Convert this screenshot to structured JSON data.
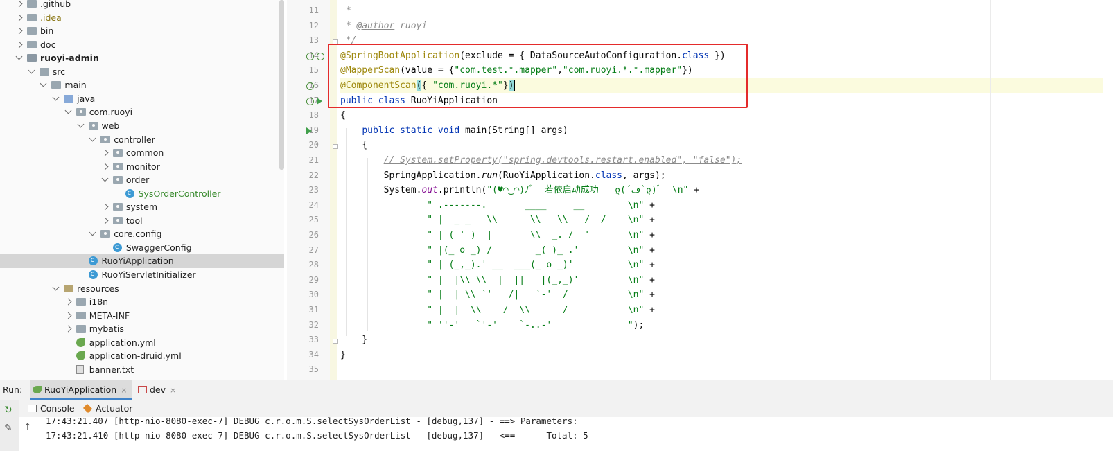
{
  "project_tree": {
    "items": [
      {
        "label": ".github",
        "depth": 0,
        "expanded": false,
        "icon": "folder",
        "style": ""
      },
      {
        "label": ".idea",
        "depth": 0,
        "expanded": false,
        "icon": "folder",
        "style": "yellow"
      },
      {
        "label": "bin",
        "depth": 0,
        "expanded": false,
        "icon": "folder",
        "style": ""
      },
      {
        "label": "doc",
        "depth": 0,
        "expanded": false,
        "icon": "folder",
        "style": ""
      },
      {
        "label": "ruoyi-admin",
        "depth": 0,
        "expanded": true,
        "icon": "module",
        "style": "bold"
      },
      {
        "label": "src",
        "depth": 1,
        "expanded": true,
        "icon": "folder",
        "style": ""
      },
      {
        "label": "main",
        "depth": 2,
        "expanded": true,
        "icon": "folder",
        "style": ""
      },
      {
        "label": "java",
        "depth": 3,
        "expanded": true,
        "icon": "src",
        "style": ""
      },
      {
        "label": "com.ruoyi",
        "depth": 4,
        "expanded": true,
        "icon": "pkg",
        "style": ""
      },
      {
        "label": "web",
        "depth": 5,
        "expanded": true,
        "icon": "pkg",
        "style": ""
      },
      {
        "label": "controller",
        "depth": 6,
        "expanded": true,
        "icon": "pkg",
        "style": ""
      },
      {
        "label": "common",
        "depth": 7,
        "expanded": false,
        "icon": "pkg",
        "style": ""
      },
      {
        "label": "monitor",
        "depth": 7,
        "expanded": false,
        "icon": "pkg",
        "style": ""
      },
      {
        "label": "order",
        "depth": 7,
        "expanded": true,
        "icon": "pkg",
        "style": ""
      },
      {
        "label": "SysOrderController",
        "depth": 8,
        "expanded": null,
        "icon": "class",
        "style": "green"
      },
      {
        "label": "system",
        "depth": 7,
        "expanded": false,
        "icon": "pkg",
        "style": ""
      },
      {
        "label": "tool",
        "depth": 7,
        "expanded": false,
        "icon": "pkg",
        "style": ""
      },
      {
        "label": "core.config",
        "depth": 6,
        "expanded": true,
        "icon": "pkg",
        "style": ""
      },
      {
        "label": "SwaggerConfig",
        "depth": 7,
        "expanded": null,
        "icon": "class",
        "style": ""
      },
      {
        "label": "RuoYiApplication",
        "depth": 5,
        "expanded": null,
        "icon": "class",
        "style": "",
        "selected": true
      },
      {
        "label": "RuoYiServletInitializer",
        "depth": 5,
        "expanded": null,
        "icon": "class",
        "style": ""
      },
      {
        "label": "resources",
        "depth": 3,
        "expanded": true,
        "icon": "res",
        "style": ""
      },
      {
        "label": "i18n",
        "depth": 4,
        "expanded": false,
        "icon": "folder",
        "style": ""
      },
      {
        "label": "META-INF",
        "depth": 4,
        "expanded": false,
        "icon": "folder",
        "style": ""
      },
      {
        "label": "mybatis",
        "depth": 4,
        "expanded": false,
        "icon": "folder",
        "style": ""
      },
      {
        "label": "application.yml",
        "depth": 4,
        "expanded": null,
        "icon": "yml",
        "style": ""
      },
      {
        "label": "application-druid.yml",
        "depth": 4,
        "expanded": null,
        "icon": "yml",
        "style": ""
      },
      {
        "label": "banner.txt",
        "depth": 4,
        "expanded": null,
        "icon": "txt",
        "style": ""
      }
    ]
  },
  "editor": {
    "first_line": 11,
    "lines": [
      [
        [
          "cmt",
          " *"
        ]
      ],
      [
        [
          "cmt",
          " * "
        ],
        [
          "tag",
          "@author"
        ],
        [
          "cmt",
          " ruoyi"
        ]
      ],
      [
        [
          "cmt",
          " */"
        ]
      ],
      [
        [
          "anno",
          "@SpringBootApplication"
        ],
        [
          "",
          "(exclude = { DataSourceAutoConfiguration."
        ],
        [
          "kw",
          "class"
        ],
        [
          "",
          " })"
        ]
      ],
      [
        [
          "anno",
          "@MapperScan"
        ],
        [
          "",
          "(value = {"
        ],
        [
          "str",
          "\"com.test.*.mapper\""
        ],
        [
          "",
          ","
        ],
        [
          "str",
          "\"com.ruoyi.*.*.mapper\""
        ],
        [
          "",
          "})"
        ]
      ],
      [
        [
          "anno",
          "@ComponentScan"
        ],
        [
          "brk",
          "("
        ],
        [
          "",
          "{ "
        ],
        [
          "str",
          "\"com.ruoyi.*\""
        ],
        [
          "",
          "}"
        ],
        [
          "brk",
          ")"
        ],
        [
          "caret",
          ""
        ]
      ],
      [
        [
          "kw",
          "public class"
        ],
        [
          "",
          " RuoYiApplication"
        ]
      ],
      [
        [
          "",
          "{"
        ]
      ],
      [
        [
          "",
          "    "
        ],
        [
          "kw",
          "public static void"
        ],
        [
          "",
          " main(String[] args)"
        ]
      ],
      [
        [
          "",
          "    {"
        ]
      ],
      [
        [
          "",
          "        "
        ],
        [
          "lcmt",
          "// System.setProperty(\"spring.devtools.restart.enabled\", \"false\");"
        ]
      ],
      [
        [
          "",
          "        SpringApplication."
        ],
        [
          "itb",
          "run"
        ],
        [
          "",
          "(RuoYiApplication."
        ],
        [
          "kw",
          "class"
        ],
        [
          "",
          ", args);"
        ]
      ],
      [
        [
          "",
          "        System."
        ],
        [
          "it",
          "out"
        ],
        [
          "",
          ".println("
        ],
        [
          "str",
          "\"(♥◠‿◠)ﾉﾞ  若依启动成功   ლ(´ڡ`ლ)ﾞ  \\n\""
        ],
        [
          "",
          " +"
        ]
      ],
      [
        [
          "",
          "                "
        ],
        [
          "str",
          "\" .-------.       ____     __        \\n\""
        ],
        [
          "",
          " +"
        ]
      ],
      [
        [
          "",
          "                "
        ],
        [
          "str",
          "\" |  _ _   \\\\      \\\\   \\\\   /  /    \\n\""
        ],
        [
          "",
          " +"
        ]
      ],
      [
        [
          "",
          "                "
        ],
        [
          "str",
          "\" | ( ' )  |       \\\\  _. /  '       \\n\""
        ],
        [
          "",
          " +"
        ]
      ],
      [
        [
          "",
          "                "
        ],
        [
          "str",
          "\" |(_ o _) /        _( )_ .'         \\n\""
        ],
        [
          "",
          " +"
        ]
      ],
      [
        [
          "",
          "                "
        ],
        [
          "str",
          "\" | (_,_).' __  ___(_ o _)'          \\n\""
        ],
        [
          "",
          " +"
        ]
      ],
      [
        [
          "",
          "                "
        ],
        [
          "str",
          "\" |  |\\\\ \\\\  |  ||   |(_,_)'         \\n\""
        ],
        [
          "",
          " +"
        ]
      ],
      [
        [
          "",
          "                "
        ],
        [
          "str",
          "\" |  | \\\\ `'   /|   `-'  /           \\n\""
        ],
        [
          "",
          " +"
        ]
      ],
      [
        [
          "",
          "                "
        ],
        [
          "str",
          "\" |  |  \\\\    /  \\\\      /           \\n\""
        ],
        [
          "",
          " +"
        ]
      ],
      [
        [
          "",
          "                "
        ],
        [
          "str",
          "\" ''-'   `'-'    `-..-'              \""
        ],
        [
          "",
          ");"
        ]
      ],
      [
        [
          "",
          "    }"
        ]
      ],
      [
        [
          "",
          "}"
        ]
      ],
      [
        [
          "",
          ""
        ]
      ]
    ],
    "gutter_icons": [
      {
        "line": 14,
        "icons": [
          "bean-icon",
          "bean-icon"
        ]
      },
      {
        "line": 16,
        "icons": [
          "bean-icon"
        ]
      },
      {
        "line": 17,
        "icons": [
          "bean-icon",
          "run-icon"
        ]
      },
      {
        "line": 19,
        "icons": [
          "run-icon"
        ]
      }
    ],
    "highlighted_line": 16,
    "colors": {
      "annotation": "#9e880d",
      "keyword": "#0033b3",
      "string": "#067d17",
      "comment": "#8c8c8c",
      "highlight_box": "#e42b2b"
    }
  },
  "run_window": {
    "label": "Run:",
    "tabs": [
      {
        "label": "RuoYiApplication",
        "active": true,
        "icon": "spring-icon"
      },
      {
        "label": "dev",
        "active": false,
        "icon": "dev-icon"
      }
    ],
    "close_glyph": "×",
    "sub_tabs": [
      {
        "label": "Console",
        "icon": "console-icon"
      },
      {
        "label": "Actuator",
        "icon": "actuator-icon"
      }
    ],
    "console_lines": [
      "17:43:21.407 [http-nio-8080-exec-7] DEBUG c.r.o.m.S.selectSysOrderList - [debug,137] - ==> Parameters: ",
      "17:43:21.410 [http-nio-8080-exec-7] DEBUG c.r.o.m.S.selectSysOrderList - [debug,137] - <==      Total: 5"
    ]
  }
}
